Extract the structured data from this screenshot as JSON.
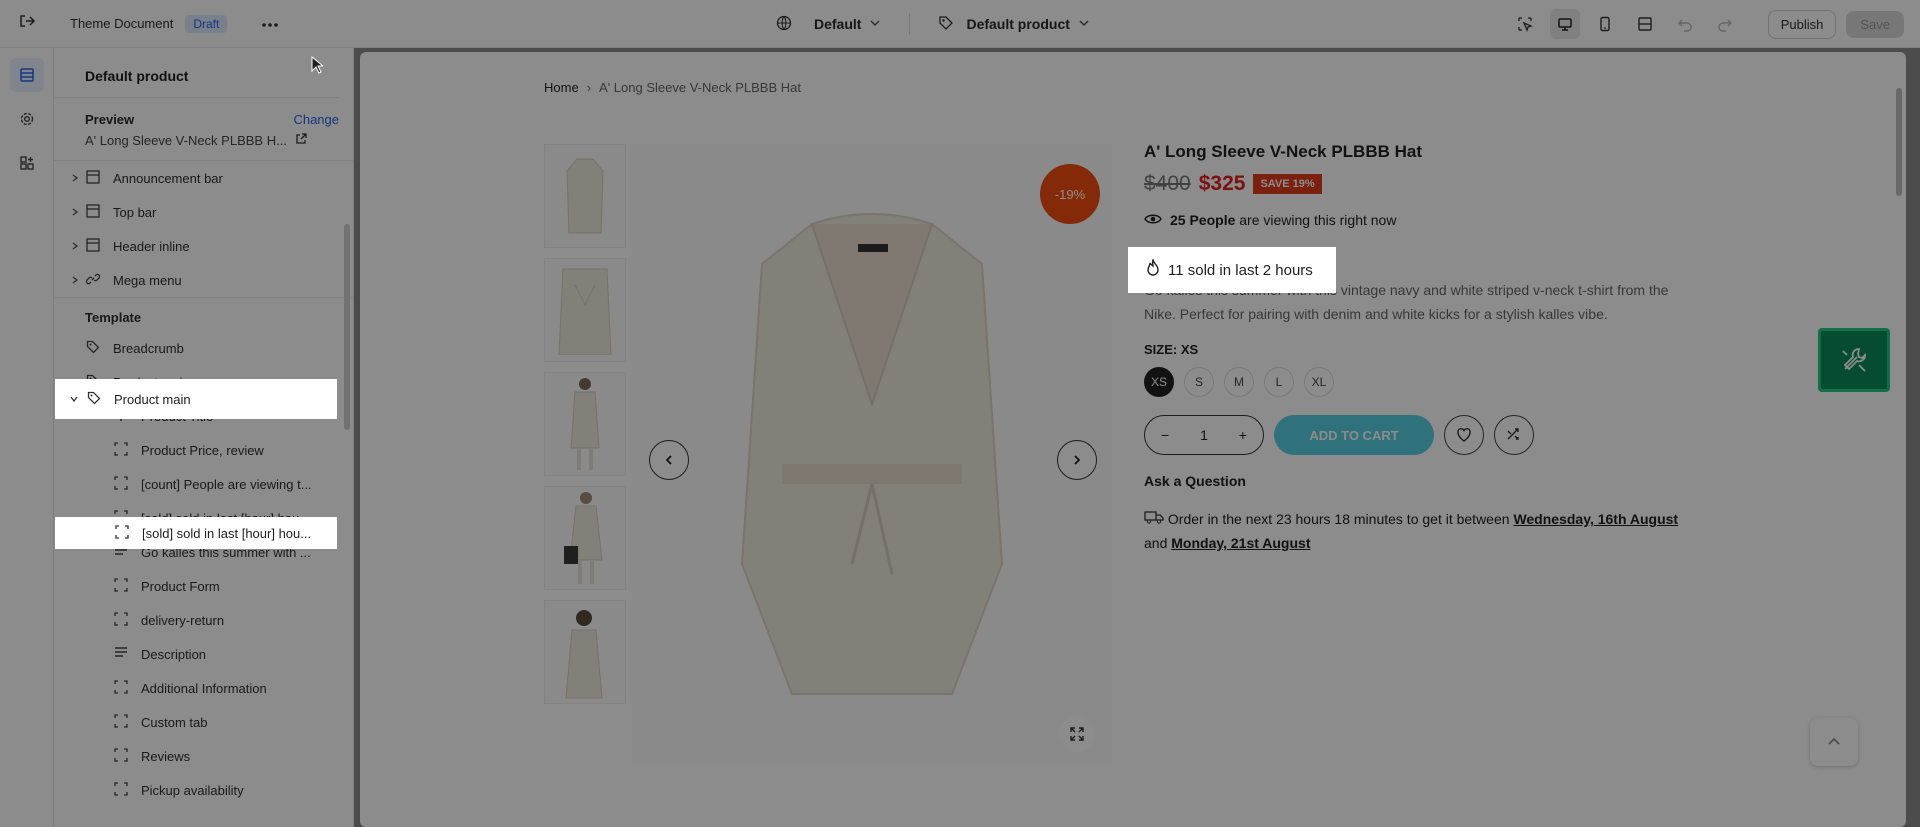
{
  "topbar": {
    "theme_title": "Theme Document",
    "status_badge": "Draft",
    "template_selector": "Default",
    "product_selector": "Default product",
    "publish_label": "Publish",
    "save_label": "Save"
  },
  "sidebar": {
    "title": "Default product",
    "preview_label": "Preview",
    "change_label": "Change",
    "preview_value": "A' Long Sleeve V-Neck PLBBB H...",
    "groups": [
      {
        "label": "Announcement bar",
        "icon": "section-icon"
      },
      {
        "label": "Top bar",
        "icon": "section-icon"
      },
      {
        "label": "Header inline",
        "icon": "section-icon"
      },
      {
        "label": "Mega menu",
        "icon": "link-icon"
      }
    ],
    "template_label": "Template",
    "template_items": [
      {
        "label": "Breadcrumb",
        "icon": "tag-icon"
      },
      {
        "label": "Product main",
        "icon": "tag-icon"
      }
    ],
    "children": [
      {
        "label": "Product Title",
        "icon": "text-icon"
      },
      {
        "label": "Product Price, review",
        "icon": "block-icon"
      },
      {
        "label": "[count] People are viewing t...",
        "icon": "block-icon"
      },
      {
        "label": "[sold] sold in last [hour] hou...",
        "icon": "block-icon"
      },
      {
        "label": "Go kalles this summer with ...",
        "icon": "paragraph-icon"
      },
      {
        "label": "Product Form",
        "icon": "block-icon"
      },
      {
        "label": "delivery-return",
        "icon": "block-icon"
      },
      {
        "label": "Description",
        "icon": "paragraph-icon"
      },
      {
        "label": "Additional Information",
        "icon": "block-icon"
      },
      {
        "label": "Custom tab",
        "icon": "block-icon"
      },
      {
        "label": "Reviews",
        "icon": "block-icon"
      },
      {
        "label": "Pickup availability",
        "icon": "block-icon"
      }
    ]
  },
  "product": {
    "breadcrumb_home": "Home",
    "breadcrumb_sep": "›",
    "breadcrumb_current": "A' Long Sleeve V-Neck PLBBB Hat",
    "sale_badge": "-19%",
    "title": "A' Long Sleeve V-Neck PLBBB Hat",
    "price_old": "$400",
    "price_new": "$325",
    "save_badge": "SAVE 19%",
    "viewing_count": "25 People",
    "viewing_text": "are viewing this right now",
    "sold_text": "11 sold in last 2 hours",
    "description": "Go kalles this summer with this vintage navy and white striped v-neck t-shirt from the Nike. Perfect for pairing with denim and white kicks for a stylish kalles vibe.",
    "size_label": "SIZE: XS",
    "sizes": [
      "XS",
      "S",
      "M",
      "L",
      "XL"
    ],
    "qty_value": "1",
    "qty_minus": "−",
    "qty_plus": "+",
    "add_to_cart": "ADD TO CART",
    "ask_question": "Ask a Question",
    "delivery_prefix": "Order in the next 23 hours 18 minutes to get it between",
    "delivery_date1": "Wednesday, 16th August",
    "delivery_and": "and",
    "delivery_date2": "Monday, 21st August"
  },
  "colors": {
    "accent": "#2563eb",
    "sale_red": "#e02020",
    "add_cart": "#56cfe1",
    "tool_green": "#0c8a5c"
  }
}
